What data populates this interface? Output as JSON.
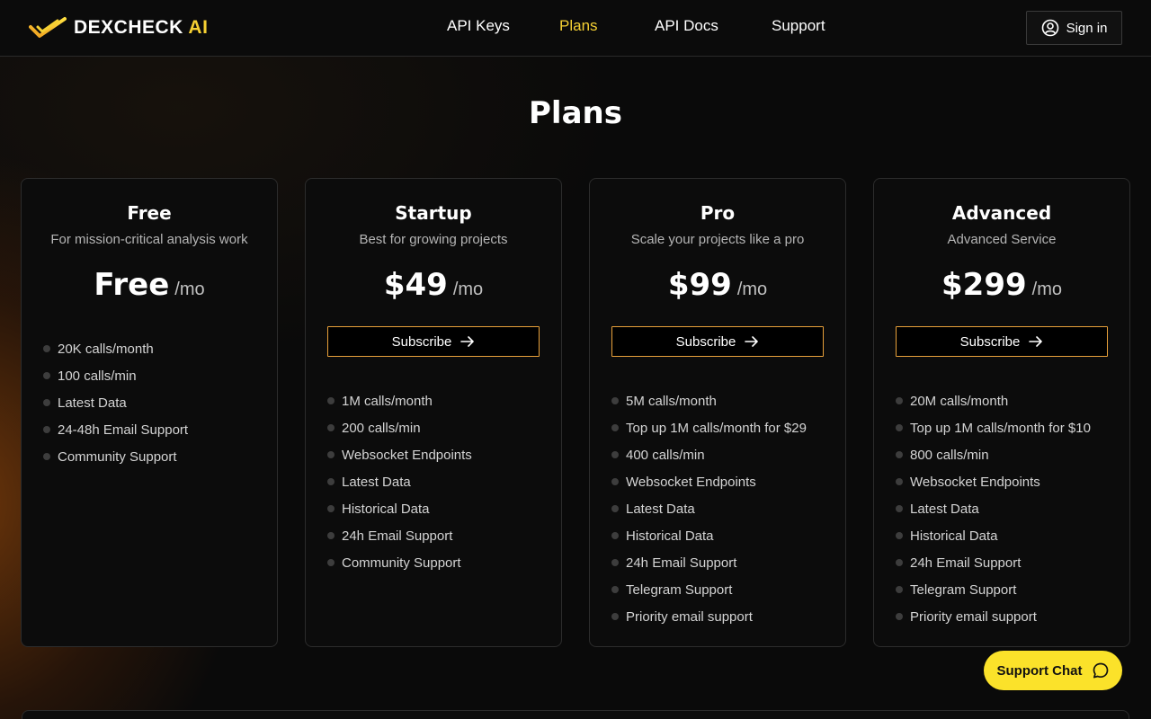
{
  "brand": {
    "name": "DEXCHECK",
    "suffix": "AI",
    "accent": "#f5d033"
  },
  "nav": {
    "items": [
      {
        "label": "API Keys"
      },
      {
        "label": "Plans",
        "active": true
      },
      {
        "label": "API Docs"
      },
      {
        "label": "Support"
      }
    ]
  },
  "header": {
    "signin_label": "Sign in"
  },
  "page": {
    "title": "Plans"
  },
  "plans": [
    {
      "name": "Free",
      "description": "For mission-critical analysis work",
      "price": "Free",
      "period": "/mo",
      "features": [
        "20K calls/month",
        "100 calls/min",
        "Latest Data",
        "24-48h Email Support",
        "Community Support"
      ]
    },
    {
      "name": "Startup",
      "description": "Best for growing projects",
      "price": "$49",
      "period": "/mo",
      "subscribe_label": "Subscribe",
      "features": [
        "1M calls/month",
        "200 calls/min",
        "Websocket Endpoints",
        "Latest Data",
        "Historical Data",
        "24h Email Support",
        "Community Support"
      ]
    },
    {
      "name": "Pro",
      "description": "Scale your projects like a pro",
      "price": "$99",
      "period": "/mo",
      "subscribe_label": "Subscribe",
      "features": [
        "5M calls/month",
        "Top up 1M calls/month for $29",
        "400 calls/min",
        "Websocket Endpoints",
        "Latest Data",
        "Historical Data",
        "24h Email Support",
        "Telegram Support",
        "Priority email support"
      ]
    },
    {
      "name": "Advanced",
      "description": "Advanced Service",
      "price": "$299",
      "period": "/mo",
      "subscribe_label": "Subscribe",
      "features": [
        "20M calls/month",
        "Top up 1M calls/month for $10",
        "800 calls/min",
        "Websocket Endpoints",
        "Latest Data",
        "Historical Data",
        "24h Email Support",
        "Telegram Support",
        "Priority email support"
      ]
    }
  ],
  "support_chat": {
    "label": "Support Chat"
  },
  "icons": {
    "signin": "user-circle-icon",
    "subscribe": "arrow-right-icon",
    "chat": "chat-bubble-icon",
    "logo": "checkmark-logo-icon"
  },
  "colors": {
    "accent_yellow": "#f5d033",
    "button_border": "#e8a03a",
    "chat_bg": "#fbe22a",
    "background": "#0b0b0b"
  }
}
